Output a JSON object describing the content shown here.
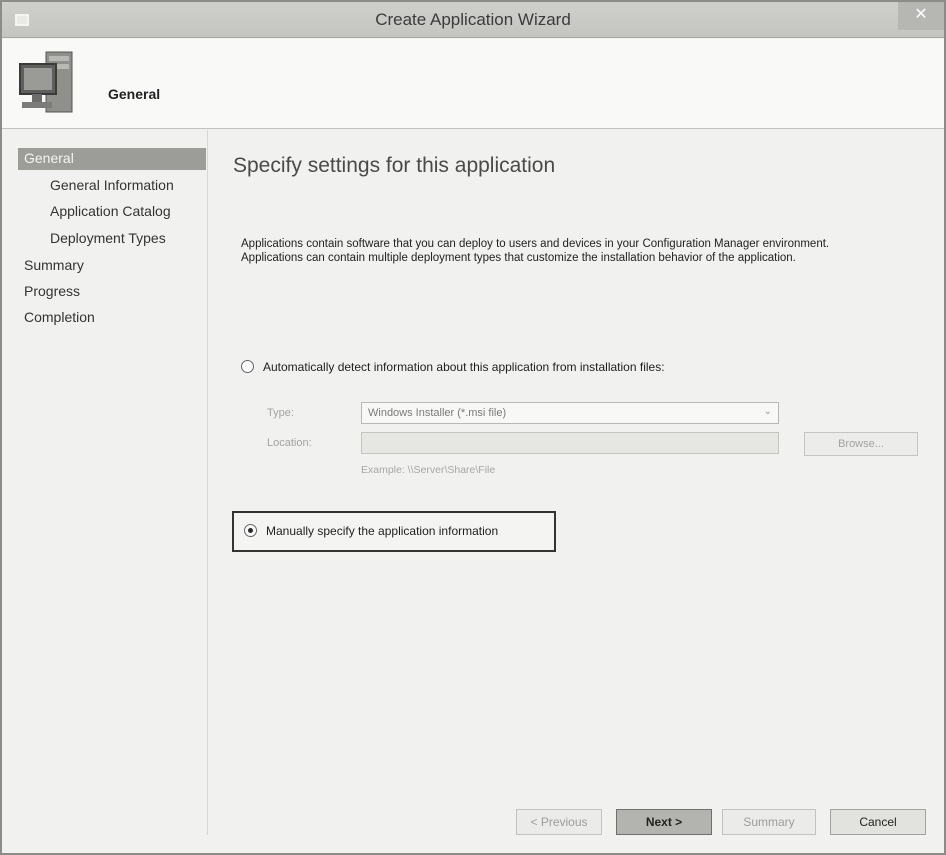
{
  "window": {
    "title": "Create Application Wizard",
    "close_glyph": "✕"
  },
  "header": {
    "title": "General",
    "icon": "computer-icon"
  },
  "nav": {
    "items": [
      {
        "label": "General",
        "level": 0,
        "active": true
      },
      {
        "label": "General Information",
        "level": 1,
        "active": false
      },
      {
        "label": "Application Catalog",
        "level": 1,
        "active": false
      },
      {
        "label": "Deployment Types",
        "level": 1,
        "active": false
      },
      {
        "label": "Summary",
        "level": 0,
        "active": false
      },
      {
        "label": "Progress",
        "level": 0,
        "active": false
      },
      {
        "label": "Completion",
        "level": 0,
        "active": false
      }
    ]
  },
  "main": {
    "heading": "Specify settings for this application",
    "description_line1": "Applications contain software that you can deploy to users and devices in your Configuration Manager environment.",
    "description_line2": "Applications can contain multiple deployment types that customize the installation behavior of the application.",
    "auto_detect": {
      "label": "Automatically detect information about this application from installation files:",
      "selected": false,
      "type_label": "Type:",
      "type_value": "Windows Installer (*.msi file)",
      "location_label": "Location:",
      "location_value": "",
      "browse_label": "Browse...",
      "example": "Example: \\\\Server\\Share\\File"
    },
    "manual": {
      "label": "Manually specify the application information",
      "selected": true
    }
  },
  "buttons": {
    "previous": "< Previous",
    "next": "Next >",
    "summary": "Summary",
    "cancel": "Cancel"
  }
}
